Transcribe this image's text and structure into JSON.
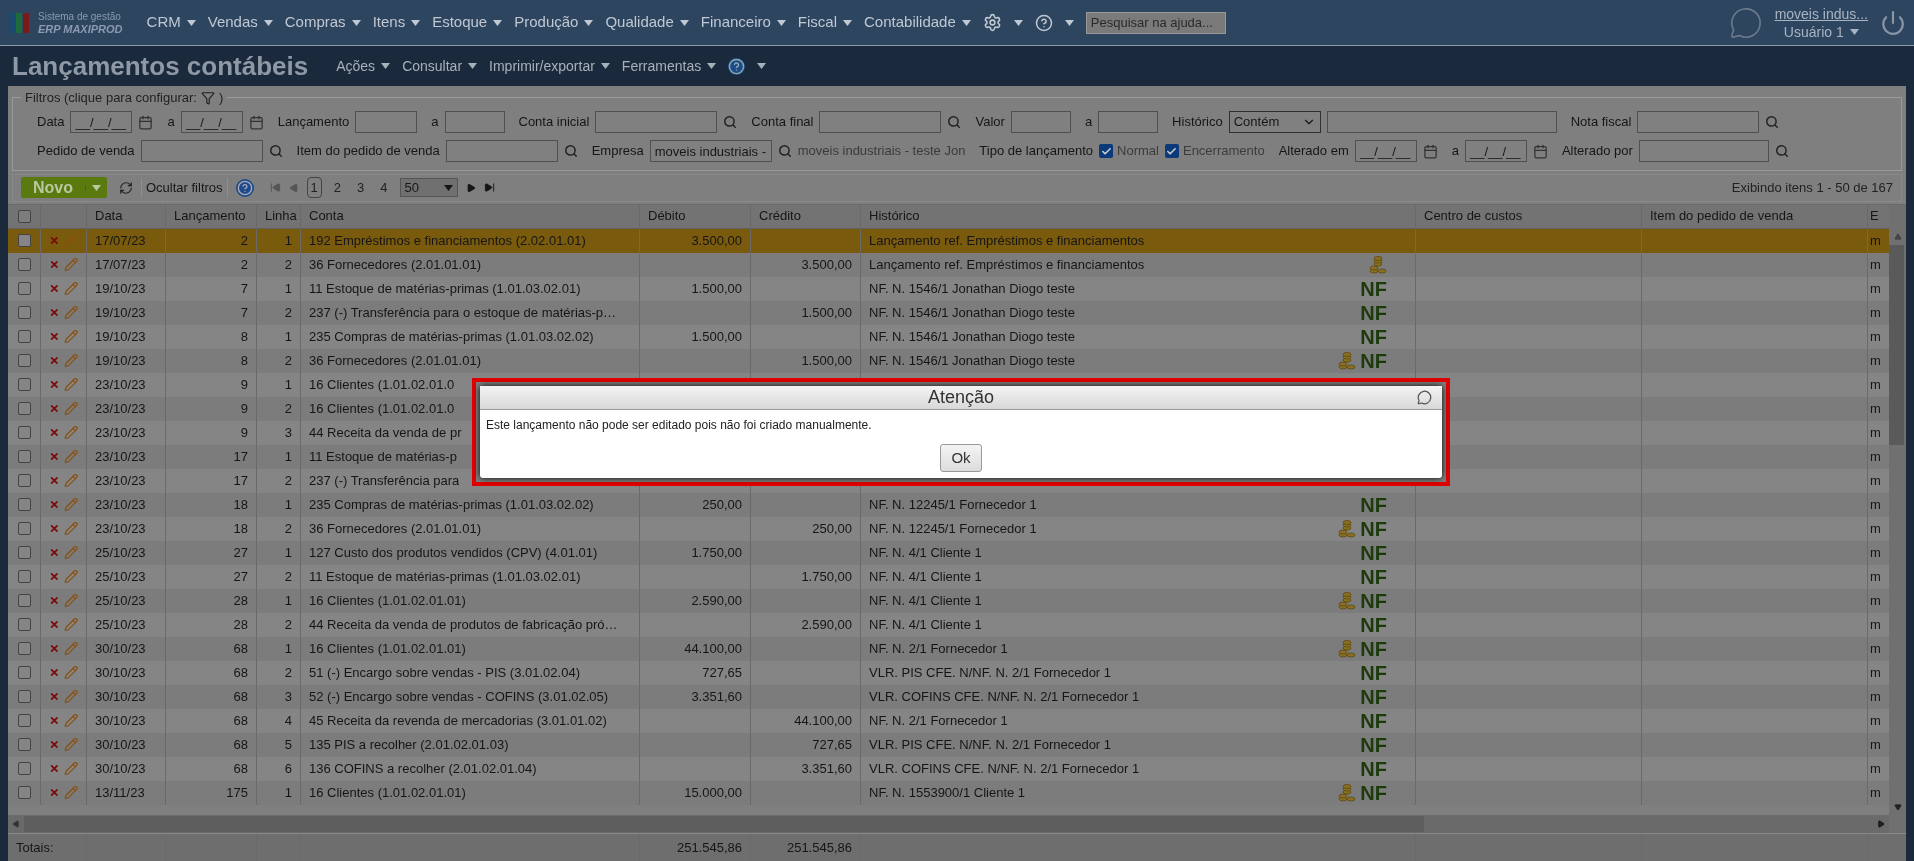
{
  "app": {
    "logo_line1": "Sistema de gestão",
    "logo_line2": "ERP MAXIPROD"
  },
  "nav": {
    "menus": [
      "CRM",
      "Vendas",
      "Compras",
      "Itens",
      "Estoque",
      "Produção",
      "Qualidade",
      "Financeiro",
      "Fiscal",
      "Contabilidade"
    ],
    "search_placeholder": "Pesquisar na ajuda...",
    "company": "moveis indus...",
    "user": "Usuário 1"
  },
  "page": {
    "title": "Lançamentos contábeis",
    "menus": [
      "Ações",
      "Consultar",
      "Imprimir/exportar",
      "Ferramentas"
    ]
  },
  "filters": {
    "legend_start": "Filtros (clique para configurar:",
    "legend_end": ")",
    "first_line": [
      {
        "kind": "label",
        "text": "Data"
      },
      {
        "kind": "date",
        "value": "__/__/__"
      },
      {
        "kind": "calendar"
      },
      {
        "kind": "label",
        "text": "a"
      },
      {
        "kind": "date",
        "value": "__/__/__"
      },
      {
        "kind": "calendar"
      },
      {
        "kind": "label",
        "text": "Lançamento"
      },
      {
        "kind": "input"
      },
      {
        "kind": "label",
        "text": "a"
      },
      {
        "kind": "input"
      },
      {
        "kind": "label",
        "text": "Conta inicial"
      },
      {
        "kind": "input"
      },
      {
        "kind": "lookup"
      },
      {
        "kind": "label",
        "text": "Conta final"
      },
      {
        "kind": "input"
      },
      {
        "kind": "lookup"
      },
      {
        "kind": "label",
        "text": "Valor"
      },
      {
        "kind": "input"
      },
      {
        "kind": "label",
        "text": "a"
      },
      {
        "kind": "input"
      },
      {
        "kind": "label",
        "text": "Histórico"
      },
      {
        "kind": "select",
        "value": "Contém"
      },
      {
        "kind": "input"
      },
      {
        "kind": "label",
        "text": "Nota fiscal"
      },
      {
        "kind": "input"
      },
      {
        "kind": "lookup"
      }
    ],
    "second_line": [
      {
        "kind": "label",
        "text": "Pedido de venda"
      },
      {
        "kind": "input"
      },
      {
        "kind": "lookup"
      },
      {
        "kind": "label",
        "text": "Item do pedido de venda"
      },
      {
        "kind": "input"
      },
      {
        "kind": "lookup"
      },
      {
        "kind": "label",
        "text": "Empresa"
      },
      {
        "kind": "input",
        "value": "moveis industriais -"
      },
      {
        "kind": "lookup"
      },
      {
        "kind": "note",
        "text": "moveis industriais - teste Jon"
      },
      {
        "kind": "label",
        "text": "Tipo de lançamento"
      },
      {
        "kind": "checkbox",
        "text": "Normal",
        "checked": true
      },
      {
        "kind": "checkbox",
        "text": "Encerramento",
        "checked": true
      },
      {
        "kind": "label",
        "text": "Alterado em"
      },
      {
        "kind": "date",
        "value": "__/__/__"
      },
      {
        "kind": "calendar"
      },
      {
        "kind": "label",
        "text": "a"
      },
      {
        "kind": "date",
        "value": "__/__/__"
      },
      {
        "kind": "calendar"
      },
      {
        "kind": "label",
        "text": "Alterado por"
      },
      {
        "kind": "input"
      },
      {
        "kind": "lookup"
      }
    ]
  },
  "toolbar": {
    "new_button": "Novo",
    "hide_filters": "Ocultar filtros",
    "pages": [
      {
        "label": "1",
        "selected": true
      },
      {
        "label": "2",
        "selected": false
      },
      {
        "label": "3",
        "selected": false
      },
      {
        "label": "4",
        "selected": false
      }
    ],
    "page_size": "50",
    "summary": "Exibindo itens 1 - 50 de 167"
  },
  "table": {
    "select_all_checked": false,
    "columns": [
      "Data",
      "Lançamento",
      "Linha",
      "Conta",
      "Débito",
      "Crédito",
      "Histórico",
      "Centro de custos",
      "Item do pedido de venda",
      "E"
    ],
    "rows": [
      {
        "date": "17/07/23",
        "entry": "2",
        "line": "1",
        "account": "192 Empréstimos e financiamentos (2.02.01.01)",
        "debit": "3.500,00",
        "history": "Lançamento ref. Empréstimos e financiamentos",
        "coins": false,
        "column_10": "m",
        "checked": false,
        "selected": true
      },
      {
        "date": "17/07/23",
        "entry": "2",
        "line": "2",
        "account": "36 Fornecedores (2.01.01.01)",
        "credit": "3.500,00",
        "history": "Lançamento ref. Empréstimos e financiamentos",
        "coins": true,
        "column_10": "m",
        "checked": false,
        "selected": false
      },
      {
        "date": "19/10/23",
        "entry": "7",
        "line": "1",
        "account": "11 Estoque de matérias-primas (1.01.03.02.01)",
        "debit": "1.500,00",
        "history": "NF. N. 1546/1 Jonathan Diogo teste",
        "coins": false,
        "badge": "NF",
        "column_10": "m",
        "checked": false,
        "selected": false
      },
      {
        "date": "19/10/23",
        "entry": "7",
        "line": "2",
        "account": "237 (-) Transferência para o estoque de matérias-p…",
        "credit": "1.500,00",
        "history": "NF. N. 1546/1 Jonathan Diogo teste",
        "coins": false,
        "badge": "NF",
        "column_10": "m",
        "checked": false,
        "selected": false
      },
      {
        "date": "19/10/23",
        "entry": "8",
        "line": "1",
        "account": "235 Compras de matérias-primas (1.01.03.02.02)",
        "debit": "1.500,00",
        "history": "NF. N. 1546/1 Jonathan Diogo teste",
        "coins": false,
        "badge": "NF",
        "column_10": "m",
        "checked": false,
        "selected": false
      },
      {
        "date": "19/10/23",
        "entry": "8",
        "line": "2",
        "account": "36 Fornecedores (2.01.01.01)",
        "credit": "1.500,00",
        "history": "NF. N. 1546/1 Jonathan Diogo teste",
        "coins": true,
        "badge": "NF",
        "column_10": "m",
        "checked": false,
        "selected": false
      },
      {
        "date": "23/10/23",
        "entry": "9",
        "line": "1",
        "account": "16 Clientes (1.01.02.01.0",
        "coins": false,
        "column_10": "m",
        "checked": false,
        "selected": false
      },
      {
        "date": "23/10/23",
        "entry": "9",
        "line": "2",
        "account": "16 Clientes (1.01.02.01.0",
        "coins": false,
        "column_10": "m",
        "checked": false,
        "selected": false
      },
      {
        "date": "23/10/23",
        "entry": "9",
        "line": "3",
        "account": "44 Receita da venda de pr",
        "coins": false,
        "column_10": "m",
        "checked": false,
        "selected": false
      },
      {
        "date": "23/10/23",
        "entry": "17",
        "line": "1",
        "account": "11 Estoque de matérias-p",
        "coins": false,
        "column_10": "m",
        "checked": false,
        "selected": false
      },
      {
        "date": "23/10/23",
        "entry": "17",
        "line": "2",
        "account": "237 (-) Transferência para",
        "coins": false,
        "column_10": "m",
        "checked": false,
        "selected": false
      },
      {
        "date": "23/10/23",
        "entry": "18",
        "line": "1",
        "account": "235 Compras de matérias-primas (1.01.03.02.02)",
        "debit": "250,00",
        "history": "NF. N. 12245/1 Fornecedor 1",
        "coins": false,
        "badge": "NF",
        "column_10": "m",
        "checked": false,
        "selected": false
      },
      {
        "date": "23/10/23",
        "entry": "18",
        "line": "2",
        "account": "36 Fornecedores (2.01.01.01)",
        "credit": "250,00",
        "history": "NF. N. 12245/1 Fornecedor 1",
        "coins": true,
        "badge": "NF",
        "column_10": "m",
        "checked": false,
        "selected": false
      },
      {
        "date": "25/10/23",
        "entry": "27",
        "line": "1",
        "account": "127 Custo dos produtos vendidos (CPV) (4.01.01)",
        "debit": "1.750,00",
        "history": "NF. N. 4/1 Cliente 1",
        "coins": false,
        "badge": "NF",
        "column_10": "m",
        "checked": false,
        "selected": false
      },
      {
        "date": "25/10/23",
        "entry": "27",
        "line": "2",
        "account": "11 Estoque de matérias-primas (1.01.03.02.01)",
        "credit": "1.750,00",
        "history": "NF. N. 4/1 Cliente 1",
        "coins": false,
        "badge": "NF",
        "column_10": "m",
        "checked": false,
        "selected": false
      },
      {
        "date": "25/10/23",
        "entry": "28",
        "line": "1",
        "account": "16 Clientes (1.01.02.01.01)",
        "debit": "2.590,00",
        "history": "NF. N. 4/1 Cliente 1",
        "coins": true,
        "badge": "NF",
        "column_10": "m",
        "checked": false,
        "selected": false
      },
      {
        "date": "25/10/23",
        "entry": "28",
        "line": "2",
        "account": "44 Receita da venda de produtos de fabricação pró…",
        "credit": "2.590,00",
        "history": "NF. N. 4/1 Cliente 1",
        "coins": false,
        "badge": "NF",
        "column_10": "m",
        "checked": false,
        "selected": false
      },
      {
        "date": "30/10/23",
        "entry": "68",
        "line": "1",
        "account": "16 Clientes (1.01.02.01.01)",
        "debit": "44.100,00",
        "history": "NF. N. 2/1 Fornecedor 1",
        "coins": true,
        "badge": "NF",
        "column_10": "m",
        "checked": false,
        "selected": false
      },
      {
        "date": "30/10/23",
        "entry": "68",
        "line": "2",
        "account": "51 (-) Encargo sobre vendas - PIS (3.01.02.04)",
        "debit": "727,65",
        "history": "VLR. PIS CFE. N/NF. N. 2/1 Fornecedor 1",
        "coins": false,
        "badge": "NF",
        "column_10": "m",
        "checked": false,
        "selected": false
      },
      {
        "date": "30/10/23",
        "entry": "68",
        "line": "3",
        "account": "52 (-) Encargo sobre vendas - COFINS (3.01.02.05)",
        "debit": "3.351,60",
        "history": "VLR. COFINS CFE. N/NF. N. 2/1 Fornecedor 1",
        "coins": false,
        "badge": "NF",
        "column_10": "m",
        "checked": false,
        "selected": false
      },
      {
        "date": "30/10/23",
        "entry": "68",
        "line": "4",
        "account": "45 Receita da revenda de mercadorias (3.01.01.02)",
        "credit": "44.100,00",
        "history": "NF. N. 2/1 Fornecedor 1",
        "coins": false,
        "badge": "NF",
        "column_10": "m",
        "checked": false,
        "selected": false
      },
      {
        "date": "30/10/23",
        "entry": "68",
        "line": "5",
        "account": "135 PIS a recolher (2.01.02.01.03)",
        "credit": "727,65",
        "history": "VLR. PIS CFE. N/NF. N. 2/1 Fornecedor 1",
        "coins": false,
        "badge": "NF",
        "column_10": "m",
        "checked": false,
        "selected": false
      },
      {
        "date": "30/10/23",
        "entry": "68",
        "line": "6",
        "account": "136 COFINS a recolher (2.01.02.01.04)",
        "credit": "3.351,60",
        "history": "VLR. COFINS CFE. N/NF. N. 2/1 Fornecedor 1",
        "coins": false,
        "badge": "NF",
        "column_10": "m",
        "checked": false,
        "selected": false
      },
      {
        "date": "13/11/23",
        "entry": "175",
        "line": "1",
        "account": "16 Clientes (1.01.02.01.01)",
        "debit": "15.000,00",
        "history": "NF. N. 1553900/1 Cliente 1",
        "coins": true,
        "badge": "NF",
        "column_10": "m",
        "checked": false,
        "selected": false
      }
    ],
    "totals": {
      "label": "Totais:",
      "debit": "251.545,86",
      "credit": "251.545,86"
    }
  },
  "dialog": {
    "title": "Atenção",
    "message": "Este lançamento não pode ser editado pois não foi criado manualmente.",
    "button": "Ok"
  }
}
